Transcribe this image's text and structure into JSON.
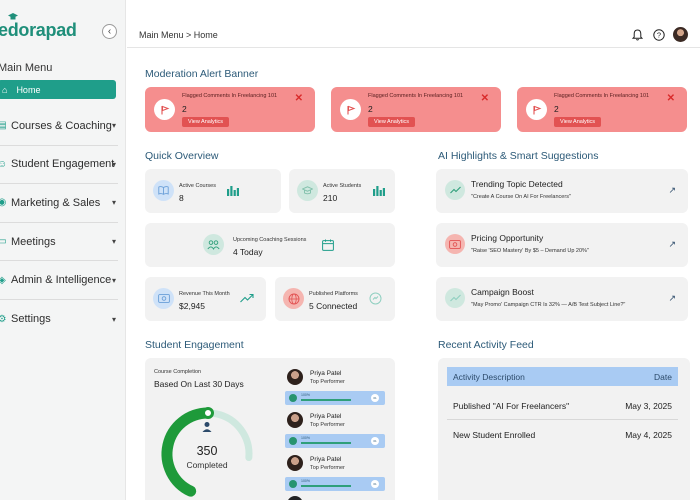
{
  "logo": "edorapad",
  "sidebar": {
    "menu_title": "Main Menu",
    "home": "Home",
    "items": [
      {
        "label": "Courses & Coaching"
      },
      {
        "label": "Student Engagement"
      },
      {
        "label": "Marketing & Sales"
      },
      {
        "label": "Meetings"
      },
      {
        "label": "Admin & Intelligence"
      },
      {
        "label": "Settings"
      }
    ]
  },
  "header": {
    "breadcrumb": "Main Menu > Home"
  },
  "sections": {
    "alerts": "Moderation Alert Banner",
    "overview": "Quick Overview",
    "ai": "AI Highlights & Smart Suggestions",
    "engagement": "Student Engagement",
    "activity": "Recent Activity Feed"
  },
  "alerts": [
    {
      "title": "Flagged Comments In Freelancing 101",
      "count": "2",
      "button": "View Analytics"
    },
    {
      "title": "Flagged Comments In Freelancing 101",
      "count": "2",
      "button": "View Analytics"
    },
    {
      "title": "Flagged Comments In Freelancing 101",
      "count": "2",
      "button": "View Analytics"
    }
  ],
  "overview": {
    "active_courses": {
      "label": "Active Courses",
      "value": "8"
    },
    "active_students": {
      "label": "Active Students",
      "value": "210"
    },
    "coaching": {
      "label": "Upcoming Coaching Sessions",
      "value": "4 Today"
    },
    "revenue": {
      "label": "Revenue This Month",
      "value": "$2,945"
    },
    "platforms": {
      "label": "Published Platforms",
      "value": "5 Connected"
    }
  },
  "ai": [
    {
      "title": "Trending Topic Detected",
      "desc": "\"Create A Course On AI For Freelancers\""
    },
    {
      "title": "Pricing Opportunity",
      "desc": "\"Raise 'SEO Mastery' By $5 – Demand Up 20%\""
    },
    {
      "title": "Campaign Boost",
      "desc": "\"May Promo' Campaign CTR Is 32% — A/B Test Subject Line?\""
    }
  ],
  "engagement": {
    "label": "Course Completion",
    "sub": "Based On Last 30 Days",
    "value": "350",
    "caption": "Completed",
    "completion_fraction": 0.62,
    "performers": [
      {
        "name": "Priya Patel",
        "role": "Top Performer",
        "pct": "100%",
        "badge": "01"
      },
      {
        "name": "Priya Patel",
        "role": "Top Performer",
        "pct": "100%",
        "badge": "01"
      },
      {
        "name": "Priya Patel",
        "role": "Top Performer",
        "pct": "100%",
        "badge": "01"
      },
      {
        "name": "",
        "role": "",
        "pct": "100%",
        "badge": ""
      }
    ]
  },
  "activity": {
    "col_desc": "Activity Description",
    "col_date": "Date",
    "rows": [
      {
        "desc": "Published \"AI For Freelancers\"",
        "date": "May 3, 2025"
      },
      {
        "desc": "New Student Enrolled",
        "date": "May 4, 2025"
      }
    ]
  },
  "colors": {
    "brand": "#1f9e8a",
    "alert_bg": "#f58e8e",
    "alert_button": "#e25252",
    "card_bg": "#f2f2f2",
    "section_title": "#2c5a78",
    "table_header": "#a9cbf3"
  }
}
